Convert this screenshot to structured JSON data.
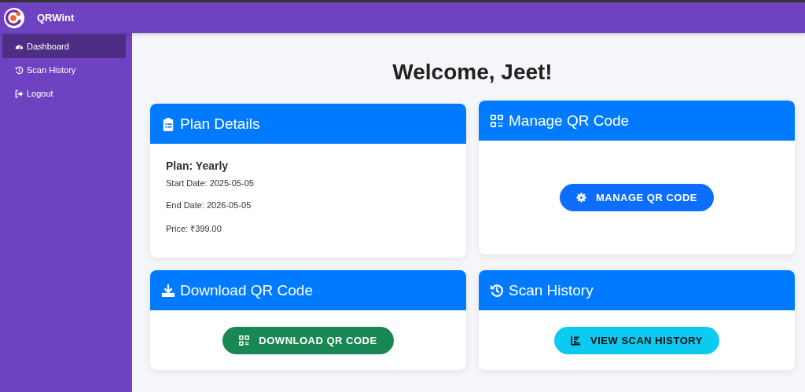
{
  "app": {
    "name": "QRWint"
  },
  "sidebar": {
    "items": [
      {
        "label": "Dashboard",
        "selected": true
      },
      {
        "label": "Scan History",
        "selected": false
      },
      {
        "label": "Logout",
        "selected": false
      }
    ]
  },
  "heading": "Welcome, Jeet!",
  "cards": [
    {
      "kind": "details",
      "title": "Plan Details",
      "plan": "Plan: Yearly",
      "lines": [
        "Start Date: 2025-05-05",
        "End Date: 2026-05-05",
        "Price: ₹399.00"
      ]
    },
    {
      "kind": "action",
      "title": "Manage QR Code",
      "button": {
        "label": "MANAGE QR CODE",
        "kind": "primary"
      }
    },
    {
      "kind": "action",
      "title": "Download QR Code",
      "button": {
        "label": "DOWNLOAD QR CODE",
        "kind": "success"
      }
    },
    {
      "kind": "action",
      "title": "Scan History",
      "button": {
        "label": "VIEW SCAN HISTORY",
        "kind": "info"
      }
    }
  ]
}
